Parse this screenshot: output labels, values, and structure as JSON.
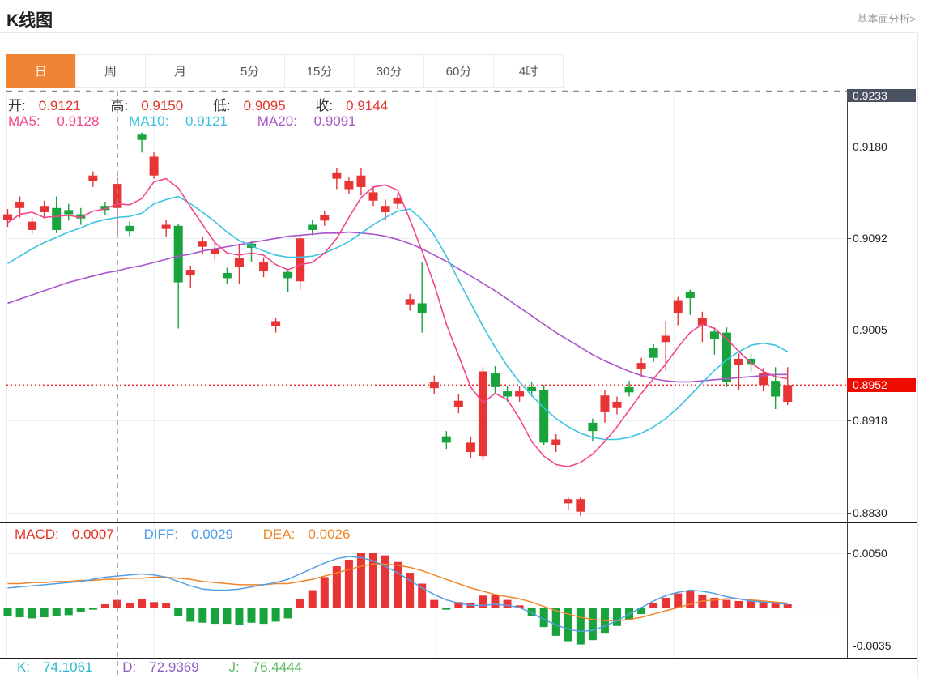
{
  "header": {
    "title": "K线图",
    "link": "基本面分析>"
  },
  "tabs": {
    "items": [
      "日",
      "周",
      "月",
      "5分",
      "15分",
      "30分",
      "60分",
      "4时"
    ],
    "active_index": 0
  },
  "legends": {
    "ohlc": [
      {
        "label": "开:",
        "value": "0.9121"
      },
      {
        "label": "高:",
        "value": "0.9150"
      },
      {
        "label": "低:",
        "value": "0.9095"
      },
      {
        "label": "收:",
        "value": "0.9144"
      }
    ],
    "ma": [
      {
        "label": "MA5:",
        "value": "0.9128"
      },
      {
        "label": "MA10:",
        "value": "0.9121"
      },
      {
        "label": "MA20:",
        "value": "0.9091"
      }
    ],
    "macd": [
      {
        "label": "MACD:",
        "value": "0.0007"
      },
      {
        "label": "DIFF:",
        "value": "0.0029"
      },
      {
        "label": "DEA:",
        "value": "0.0026"
      }
    ],
    "kdj": [
      {
        "label": "K:",
        "value": "74.1061"
      },
      {
        "label": "D:",
        "value": "72.9369"
      },
      {
        "label": "J:",
        "value": "76.4444"
      }
    ]
  },
  "colors": {
    "up": "#e83434",
    "down": "#18a33c",
    "ma5": "#f4458d",
    "ma10": "#3cc3e0",
    "ma20": "#a855cc",
    "dif": "#55a0e8",
    "dea": "#f0862c",
    "grid": "#e7eef6",
    "axis": "#3a3f4a",
    "crosshair": "#8b939e",
    "current_price_line": "#f50f0f",
    "zero_dash": "#a8d2ec",
    "badge_max_bg": "#4a5160",
    "badge_price_bg": "#ee0b00",
    "tab_active_bg": "#ef8435"
  },
  "chart_data": {
    "type": "candlestick",
    "title": "K线图 (daily)",
    "crosshair_index": 9,
    "last_price": 0.8952,
    "price_axis": {
      "max": 0.9233,
      "min": 0.883,
      "max_badge": "0.9233",
      "price_badge": "0.8952",
      "ticks": [
        {
          "label": "0.9180",
          "value": 0.918
        },
        {
          "label": "0.9092",
          "value": 0.9092
        },
        {
          "label": "0.9005",
          "value": 0.9005
        },
        {
          "label": "0.8918",
          "value": 0.8918
        },
        {
          "label": "0.8830",
          "value": 0.883
        }
      ]
    },
    "macd_axis": {
      "ticks": [
        {
          "label": "0.0050",
          "value": 0.005
        },
        {
          "label": "-0.0035",
          "value": -0.0035
        }
      ]
    },
    "candles": [
      [
        0.911,
        0.912,
        0.9103,
        0.9115
      ],
      [
        0.9121,
        0.9132,
        0.9112,
        0.9127
      ],
      [
        0.91,
        0.9112,
        0.9096,
        0.9108
      ],
      [
        0.9117,
        0.9128,
        0.9111,
        0.9123
      ],
      [
        0.9121,
        0.9132,
        0.9097,
        0.91
      ],
      [
        0.9119,
        0.9125,
        0.9109,
        0.9115
      ],
      [
        0.9115,
        0.9121,
        0.9105,
        0.9111
      ],
      [
        0.9147,
        0.9156,
        0.9141,
        0.9152
      ],
      [
        0.9123,
        0.9127,
        0.9114,
        0.9119
      ],
      [
        0.9121,
        0.915,
        0.9095,
        0.9144
      ],
      [
        0.9104,
        0.9108,
        0.9094,
        0.9099
      ],
      [
        0.9191,
        0.9193,
        0.9174,
        0.9186
      ],
      [
        0.9152,
        0.9174,
        0.9149,
        0.917
      ],
      [
        0.9101,
        0.911,
        0.9093,
        0.9105
      ],
      [
        0.9104,
        0.9106,
        0.9006,
        0.905
      ],
      [
        0.9057,
        0.9066,
        0.9045,
        0.9062
      ],
      [
        0.9084,
        0.9093,
        0.9077,
        0.9089
      ],
      [
        0.9077,
        0.9087,
        0.9071,
        0.9082
      ],
      [
        0.9059,
        0.9064,
        0.9048,
        0.9054
      ],
      [
        0.9065,
        0.9087,
        0.9048,
        0.9073
      ],
      [
        0.9087,
        0.909,
        0.9069,
        0.9083
      ],
      [
        0.9061,
        0.9074,
        0.9055,
        0.9069
      ],
      [
        0.9008,
        0.9016,
        0.9002,
        0.9013
      ],
      [
        0.906,
        0.9063,
        0.9041,
        0.9054
      ],
      [
        0.9051,
        0.9095,
        0.9043,
        0.9092
      ],
      [
        0.9105,
        0.911,
        0.9095,
        0.91
      ],
      [
        0.9109,
        0.9118,
        0.9104,
        0.9114
      ],
      [
        0.9149,
        0.9159,
        0.9139,
        0.9155
      ],
      [
        0.9139,
        0.9151,
        0.9134,
        0.9147
      ],
      [
        0.9141,
        0.9159,
        0.9133,
        0.9152
      ],
      [
        0.9128,
        0.9141,
        0.9123,
        0.9136
      ],
      [
        0.9117,
        0.9129,
        0.9109,
        0.9123
      ],
      [
        0.9125,
        0.9135,
        0.912,
        0.9131
      ],
      [
        0.9029,
        0.9039,
        0.9023,
        0.9034
      ],
      [
        0.903,
        0.9069,
        0.9002,
        0.9021
      ],
      [
        0.8949,
        0.8961,
        0.8943,
        0.8955
      ],
      [
        0.8903,
        0.8908,
        0.8891,
        0.8897
      ],
      [
        0.8931,
        0.8943,
        0.8925,
        0.8937
      ],
      [
        0.8888,
        0.8902,
        0.8882,
        0.8897
      ],
      [
        0.8884,
        0.8969,
        0.888,
        0.8965
      ],
      [
        0.8963,
        0.897,
        0.8944,
        0.895
      ],
      [
        0.8946,
        0.8951,
        0.8936,
        0.8941
      ],
      [
        0.8941,
        0.8951,
        0.8936,
        0.8946
      ],
      [
        0.895,
        0.8955,
        0.8941,
        0.8946
      ],
      [
        0.8947,
        0.8952,
        0.8895,
        0.8897
      ],
      [
        0.8895,
        0.8905,
        0.8888,
        0.89
      ],
      [
        0.8839,
        0.8845,
        0.8833,
        0.8843
      ],
      [
        0.8831,
        0.8845,
        0.8827,
        0.8843
      ],
      [
        0.8916,
        0.892,
        0.8898,
        0.8908
      ],
      [
        0.8926,
        0.8947,
        0.8916,
        0.8942
      ],
      [
        0.893,
        0.8941,
        0.8924,
        0.8936
      ],
      [
        0.895,
        0.8956,
        0.8941,
        0.8945
      ],
      [
        0.8967,
        0.8978,
        0.896,
        0.8973
      ],
      [
        0.8987,
        0.8991,
        0.8974,
        0.8978
      ],
      [
        0.8993,
        0.9013,
        0.8966,
        0.8999
      ],
      [
        0.9021,
        0.9036,
        0.9009,
        0.9033
      ],
      [
        0.9041,
        0.9043,
        0.9019,
        0.9035
      ],
      [
        0.9009,
        0.9022,
        0.8993,
        0.9016
      ],
      [
        0.9003,
        0.9007,
        0.8981,
        0.8996
      ],
      [
        0.9002,
        0.9007,
        0.895,
        0.8955
      ],
      [
        0.8971,
        0.8982,
        0.8947,
        0.8977
      ],
      [
        0.8977,
        0.8982,
        0.8965,
        0.8972
      ],
      [
        0.8952,
        0.8968,
        0.8946,
        0.8963
      ],
      [
        0.8956,
        0.8969,
        0.8929,
        0.8941
      ],
      [
        0.8936,
        0.8969,
        0.8933,
        0.8952
      ]
    ],
    "ma5": [
      0.9107,
      0.9115,
      0.9117,
      0.9112,
      0.9113,
      0.9114,
      0.9112,
      0.9118,
      0.912,
      0.9125,
      0.9124,
      0.913,
      0.9146,
      0.9149,
      0.914,
      0.9122,
      0.9105,
      0.9088,
      0.9078,
      0.9076,
      0.9078,
      0.9076,
      0.9067,
      0.9062,
      0.9067,
      0.9069,
      0.9078,
      0.9092,
      0.9112,
      0.9131,
      0.9141,
      0.9143,
      0.9138,
      0.911,
      0.908,
      0.9048,
      0.901,
      0.898,
      0.895,
      0.8935,
      0.8944,
      0.8938,
      0.892,
      0.8898,
      0.8884,
      0.8876,
      0.8874,
      0.8878,
      0.8886,
      0.8898,
      0.8912,
      0.8928,
      0.8944,
      0.8958,
      0.8972,
      0.8988,
      0.9002,
      0.901,
      0.9006,
      0.8996,
      0.8984,
      0.8973,
      0.8965,
      0.896,
      0.8958
    ],
    "ma10": [
      0.9068,
      0.9075,
      0.9082,
      0.9088,
      0.9093,
      0.9098,
      0.9102,
      0.9107,
      0.911,
      0.9112,
      0.9113,
      0.9116,
      0.9125,
      0.9129,
      0.9132,
      0.9125,
      0.9117,
      0.9108,
      0.9098,
      0.909,
      0.9085,
      0.908,
      0.9076,
      0.9074,
      0.9074,
      0.9075,
      0.9078,
      0.9083,
      0.9089,
      0.9097,
      0.9105,
      0.9112,
      0.9118,
      0.912,
      0.911,
      0.9095,
      0.9075,
      0.9052,
      0.903,
      0.9008,
      0.8988,
      0.897,
      0.8955,
      0.8942,
      0.893,
      0.892,
      0.8912,
      0.8906,
      0.8902,
      0.89,
      0.89,
      0.8902,
      0.8906,
      0.8912,
      0.892,
      0.893,
      0.8942,
      0.8954,
      0.8966,
      0.8976,
      0.8984,
      0.899,
      0.8992,
      0.899,
      0.8984
    ],
    "ma20": [
      0.903,
      0.9034,
      0.9038,
      0.9042,
      0.9046,
      0.905,
      0.9053,
      0.9056,
      0.9059,
      0.9061,
      0.9064,
      0.9066,
      0.9069,
      0.9072,
      0.9075,
      0.9077,
      0.908,
      0.9082,
      0.9084,
      0.9086,
      0.9088,
      0.909,
      0.9092,
      0.9094,
      0.9095,
      0.9096,
      0.9097,
      0.9097,
      0.9098,
      0.9097,
      0.9096,
      0.9094,
      0.9091,
      0.9087,
      0.9082,
      0.9076,
      0.907,
      0.9063,
      0.9056,
      0.9049,
      0.9042,
      0.9034,
      0.9026,
      0.9018,
      0.901,
      0.9002,
      0.8995,
      0.8988,
      0.8981,
      0.8975,
      0.897,
      0.8965,
      0.8961,
      0.8958,
      0.8956,
      0.8955,
      0.8955,
      0.8956,
      0.8957,
      0.8958,
      0.8959,
      0.896,
      0.8961,
      0.8962,
      0.8962
    ],
    "macd": {
      "dif": [
        0.0018,
        0.0019,
        0.002,
        0.0021,
        0.0022,
        0.0023,
        0.0024,
        0.0026,
        0.0028,
        0.0029,
        0.003,
        0.0031,
        0.003,
        0.0028,
        0.0024,
        0.002,
        0.0017,
        0.0016,
        0.0016,
        0.0017,
        0.0019,
        0.0021,
        0.0023,
        0.0026,
        0.0031,
        0.0036,
        0.0041,
        0.0045,
        0.0047,
        0.0046,
        0.0043,
        0.0038,
        0.0032,
        0.0025,
        0.0018,
        0.0012,
        0.0007,
        0.0004,
        0.0002,
        0.0002,
        0.0003,
        0.0002,
        0.0,
        -0.0005,
        -0.0011,
        -0.0016,
        -0.002,
        -0.0022,
        -0.0021,
        -0.0017,
        -0.0012,
        -0.0006,
        0.0,
        0.0006,
        0.0011,
        0.0014,
        0.0016,
        0.0015,
        0.0013,
        0.001,
        0.0008,
        0.0006,
        0.0005,
        0.0004,
        0.0003
      ],
      "dea": [
        0.0022,
        0.0022,
        0.0023,
        0.0023,
        0.0024,
        0.0024,
        0.0025,
        0.0025,
        0.0026,
        0.0026,
        0.0027,
        0.0027,
        0.0028,
        0.0028,
        0.0027,
        0.0026,
        0.0024,
        0.0023,
        0.0022,
        0.0021,
        0.0021,
        0.0021,
        0.0022,
        0.0022,
        0.0024,
        0.0026,
        0.0029,
        0.0032,
        0.0035,
        0.0038,
        0.004,
        0.004,
        0.0039,
        0.0037,
        0.0034,
        0.003,
        0.0026,
        0.0022,
        0.0018,
        0.0015,
        0.0012,
        0.001,
        0.0008,
        0.0005,
        0.0001,
        -0.0003,
        -0.0006,
        -0.0009,
        -0.0011,
        -0.0012,
        -0.0012,
        -0.0011,
        -0.0009,
        -0.0006,
        -0.0003,
        0.0,
        0.0003,
        0.0006,
        0.0007,
        0.0008,
        0.0008,
        0.0007,
        0.0006,
        0.0005,
        0.0004
      ],
      "histogram": [
        -0.0008,
        -0.0009,
        -0.001,
        -0.0009,
        -0.0008,
        -0.0007,
        -0.0004,
        -0.0002,
        0.0003,
        0.0007,
        0.0004,
        0.0008,
        0.0005,
        0.0004,
        -0.0008,
        -0.0013,
        -0.0014,
        -0.0015,
        -0.0015,
        -0.0016,
        -0.0014,
        -0.0015,
        -0.0013,
        -0.001,
        0.0008,
        0.0016,
        0.0028,
        0.0038,
        0.0044,
        0.005,
        0.005,
        0.0048,
        0.0042,
        0.0032,
        0.0022,
        0.0007,
        -0.0002,
        0.0005,
        0.0004,
        0.0011,
        0.0012,
        0.0007,
        0.0002,
        -0.0008,
        -0.0018,
        -0.0026,
        -0.0031,
        -0.0034,
        -0.003,
        -0.0024,
        -0.0017,
        -0.0011,
        -0.0006,
        0.0004,
        0.0009,
        0.0013,
        0.0015,
        0.0012,
        0.0009,
        0.0007,
        0.0006,
        0.0006,
        0.0005,
        0.0004,
        0.0003
      ]
    }
  }
}
